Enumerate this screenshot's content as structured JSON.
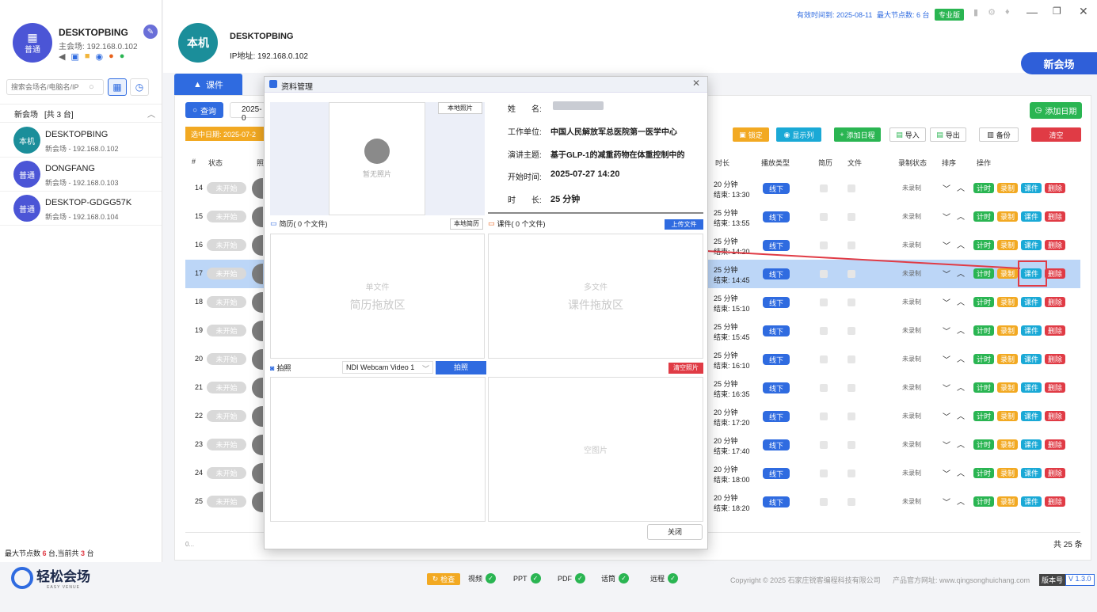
{
  "sidebar": {
    "host_name": "DESKTOPBING",
    "host_role": "主会场: 192.168.0.102",
    "badge": "普通",
    "search_placeholder": "搜索会场名/电脑名/IP",
    "group_title": "新会场",
    "group_count": "[共 3 台]",
    "items": [
      {
        "name": "DESKTOPBING",
        "sub": "新会场 - 192.168.0.102",
        "avatar": "本机",
        "color": "#1b8e9a"
      },
      {
        "name": "DONGFANG",
        "sub": "新会场 - 192.168.0.103",
        "avatar": "普通",
        "color": "#4b55d6"
      },
      {
        "name": "DESKTOP-GDGG57K",
        "sub": "新会场 - 192.168.0.104",
        "avatar": "普通",
        "color": "#4b55d6"
      }
    ],
    "footer_pre": "最大节点数 ",
    "footer_n1": "6",
    "footer_mid": " 台,当前共 ",
    "footer_n2": "3",
    "footer_suf": " 台",
    "logo_text": "轻松会场",
    "logo_sub": "EASY VENUE"
  },
  "header": {
    "avatar": "本机",
    "name": "DESKTOPBING",
    "ip": "IP地址: 192.168.0.102",
    "validity": "有效时间到: 2025-08-11",
    "max_nodes": "最大节点数: 6 台",
    "edition": "专业版",
    "new_venue": "新会场"
  },
  "main": {
    "tab": "课件",
    "query": "查询",
    "date_prefix": "2025-0",
    "selected_date": "选中日期: 2025-07-2",
    "add_date": "添加日期",
    "toolbar": [
      "锁定",
      "显示列",
      "添加日程",
      "导入",
      "导出",
      "备份",
      "清空"
    ],
    "columns": [
      "#",
      "状态",
      "照",
      "时长",
      "播放类型",
      "简历",
      "文件",
      "录制状态",
      "排序",
      "操作"
    ],
    "rows": [
      {
        "n": "14",
        "status": "未开始",
        "dur": "20 分钟",
        "end": "结束: 13:30"
      },
      {
        "n": "15",
        "status": "未开始",
        "dur": "25 分钟",
        "end": "结束: 13:55"
      },
      {
        "n": "16",
        "status": "未开始",
        "dur": "25 分钟",
        "end": "结束: 14:20"
      },
      {
        "n": "17",
        "status": "未开始",
        "dur": "25 分钟",
        "end": "结束: 14:45"
      },
      {
        "n": "18",
        "status": "未开始",
        "dur": "25 分钟",
        "end": "结束: 15:10"
      },
      {
        "n": "19",
        "status": "未开始",
        "dur": "25 分钟",
        "end": "结束: 15:45"
      },
      {
        "n": "20",
        "status": "未开始",
        "dur": "25 分钟",
        "end": "结束: 16:10"
      },
      {
        "n": "21",
        "status": "未开始",
        "dur": "25 分钟",
        "end": "结束: 16:35"
      },
      {
        "n": "22",
        "status": "未开始",
        "dur": "20 分钟",
        "end": "结束: 17:20"
      },
      {
        "n": "23",
        "status": "未开始",
        "dur": "20 分钟",
        "end": "结束: 17:40"
      },
      {
        "n": "24",
        "status": "未开始",
        "dur": "20 分钟",
        "end": "结束: 18:00"
      },
      {
        "n": "25",
        "status": "未开始",
        "dur": "20 分钟",
        "end": "结束: 18:20"
      }
    ],
    "play_type": "线下",
    "record_status": "未录制",
    "actions": [
      "计时",
      "录制",
      "课件",
      "删除"
    ],
    "total": "共 25 条",
    "pager_hint": "0..."
  },
  "dialog": {
    "title": "资料管理",
    "local_photo": "本地照片",
    "no_photo": "暂无照片",
    "name_label": "姓　　名:",
    "unit_label": "工作单位:",
    "unit": "中国人民解放军总医院第一医学中心",
    "topic_label": "演讲主题:",
    "topic": "基于GLP-1的减重药物在体重控制中的",
    "start_label": "开始时间:",
    "start": "2025-07-27 14:20",
    "dur_label": "时　　长:",
    "dur": "25 分钟",
    "resume": "简历( 0 个文件)",
    "local_resume": "本地简历",
    "courseware": "课件( 0 个文件)",
    "upload": "上传文件",
    "single_file": "单文件",
    "resume_drop": "简历拖放区",
    "multi_file": "多文件",
    "course_drop": "课件拖放区",
    "capture": "拍照",
    "camera": "NDI Webcam Video 1",
    "shoot": "拍照",
    "clear_photos": "清空照片",
    "empty_photo": "空图片",
    "close": "关闭"
  },
  "footer": {
    "check": "检查",
    "items": [
      "视频",
      "PPT",
      "PDF",
      "话筒",
      "远程"
    ],
    "copyright": "Copyright © 2025 石家庄锐客编程科技有限公司",
    "site": "产品官方网址: www.qingsonghuichang.com",
    "version_label": "版本号",
    "version": "V 1.3.0"
  },
  "colors": {
    "blue": "#2f6be0",
    "green": "#2ab552",
    "orange": "#f2a922",
    "cyan": "#1aa9d6",
    "red": "#e03b45",
    "selected_row": "#bcd6f7"
  }
}
